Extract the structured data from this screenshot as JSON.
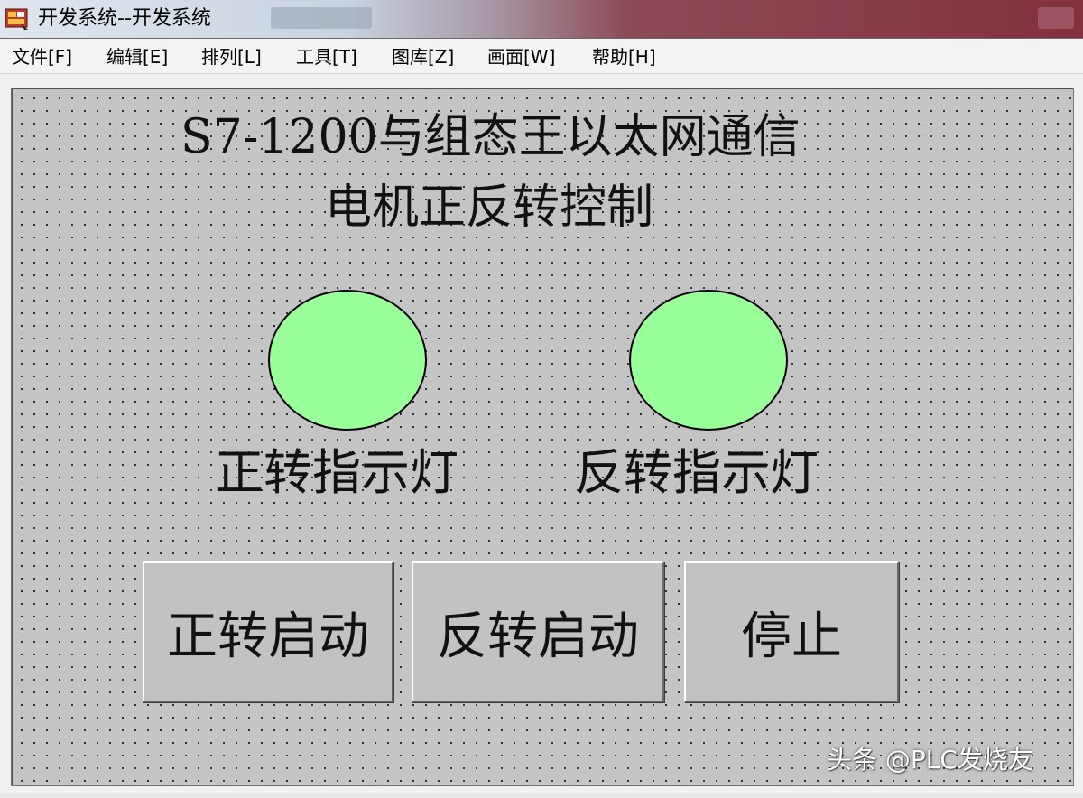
{
  "window": {
    "title": "开发系统--开发系统",
    "app_icon": "app-logo-icon"
  },
  "menu": {
    "items": [
      {
        "label": "文件[F]"
      },
      {
        "label": "编辑[E]"
      },
      {
        "label": "排列[L]"
      },
      {
        "label": "工具[T]"
      },
      {
        "label": "图库[Z]"
      },
      {
        "label": "画面[W]"
      },
      {
        "label": "帮助[H]"
      }
    ]
  },
  "screen": {
    "title_line1": "S7-1200与组态王以太网通信",
    "title_line2": "电机正反转控制",
    "indicators": [
      {
        "label": "正转指示灯",
        "color": "#99ff99",
        "state": "on"
      },
      {
        "label": "反转指示灯",
        "color": "#99ff99",
        "state": "on"
      }
    ],
    "buttons": [
      {
        "label": "正转启动"
      },
      {
        "label": "反转启动"
      },
      {
        "label": "停止"
      }
    ]
  },
  "watermark": "头条 @PLC发烧友",
  "colors": {
    "canvas_background": "#c4c4c4",
    "indicator_fill": "#99ff99",
    "button_face": "#c2c2c2"
  }
}
